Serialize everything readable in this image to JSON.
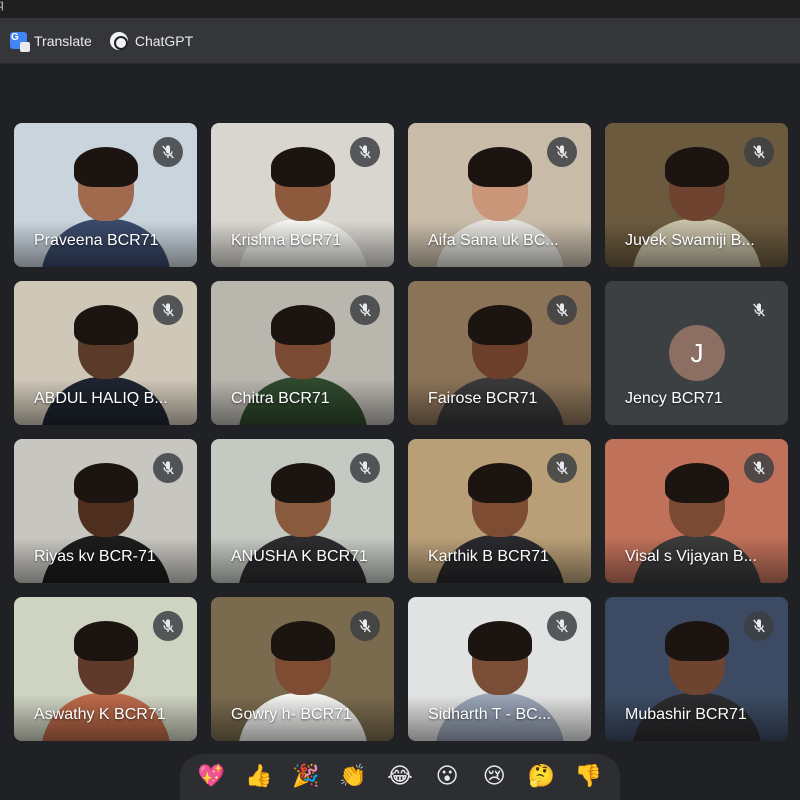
{
  "window": {
    "glyph": "q"
  },
  "bookmarks": [
    {
      "label": "Translate",
      "icon": "google-translate-icon"
    },
    {
      "label": "ChatGPT",
      "icon": "chatgpt-icon"
    }
  ],
  "participants": [
    {
      "name": "Praveena BCR71",
      "muted": true,
      "bg": "#c9d4dd",
      "skin": "#a06a4e",
      "shirt": "#3a4a6a"
    },
    {
      "name": "Krishna BCR71",
      "muted": true,
      "bg": "#d9d6cf",
      "skin": "#8e5a3d",
      "shirt": "#f2f2ef"
    },
    {
      "name": "Aifa Sana uk BC...",
      "muted": true,
      "bg": "#c8bca9",
      "skin": "#c9967a",
      "shirt": "#e4e2dd"
    },
    {
      "name": "Juvek Swamiji B...",
      "muted": true,
      "bg": "#6b5a3e",
      "skin": "#6e4330",
      "shirt": "#c7c0a8"
    },
    {
      "name": "ABDUL HALIQ B...",
      "muted": true,
      "bg": "#cfc7b8",
      "skin": "#5a3a28",
      "shirt": "#1e2430"
    },
    {
      "name": "Chitra BCR71",
      "muted": true,
      "bg": "#b9b6ae",
      "skin": "#7a4a33",
      "shirt": "#2f4a2e"
    },
    {
      "name": "Fairose BCR71",
      "muted": true,
      "bg": "#8b7358",
      "skin": "#6b3f2a",
      "shirt": "#3a3a3a"
    },
    {
      "name": "Jency BCR71",
      "muted": true,
      "bg": "#3c4043",
      "avatar": "J"
    },
    {
      "name": "Riyas kv BCR-71",
      "muted": true,
      "bg": "#c8c6c0",
      "skin": "#4e2e1f",
      "shirt": "#1c1c1c"
    },
    {
      "name": "ANUSHA K BCR71",
      "muted": true,
      "bg": "#c4c9c2",
      "skin": "#8a5a3e",
      "shirt": "#2d2d30"
    },
    {
      "name": "Karthik B BCR71",
      "muted": true,
      "bg": "#b99f78",
      "skin": "#7d4c33",
      "shirt": "#2a2a2e"
    },
    {
      "name": "Visal s Vijayan B...",
      "muted": true,
      "bg": "#c0715a",
      "skin": "#7b4a33",
      "shirt": "#3b3b3b"
    },
    {
      "name": "Aswathy K BCR71",
      "muted": true,
      "bg": "#cfd3c2",
      "skin": "#5f3a2a",
      "shirt": "#bd6a4a"
    },
    {
      "name": "Gowry h- BCR71",
      "muted": true,
      "bg": "#7a6b4e",
      "skin": "#7e4b33",
      "shirt": "#f3f3f1"
    },
    {
      "name": "Sidharth T - BC...",
      "muted": true,
      "bg": "#e1e3e2",
      "skin": "#7a4d36",
      "shirt": "#9aa5b8"
    },
    {
      "name": "Mubashir BCR71",
      "muted": true,
      "bg": "#3c4b63",
      "skin": "#6d442f",
      "shirt": "#2c2c2f"
    }
  ],
  "reactions": [
    {
      "glyph": "💖",
      "icon": "sparkling-heart-icon"
    },
    {
      "glyph": "👍",
      "icon": "thumbs-up-icon"
    },
    {
      "glyph": "🎉",
      "icon": "party-popper-icon"
    },
    {
      "glyph": "👏",
      "icon": "clapping-hands-icon"
    },
    {
      "glyph": "😂",
      "icon": "tears-of-joy-icon"
    },
    {
      "glyph": "😮",
      "icon": "surprised-face-icon"
    },
    {
      "glyph": "😢",
      "icon": "crying-face-icon"
    },
    {
      "glyph": "🤔",
      "icon": "thinking-face-icon"
    },
    {
      "glyph": "👎",
      "icon": "thumbs-down-icon"
    }
  ]
}
